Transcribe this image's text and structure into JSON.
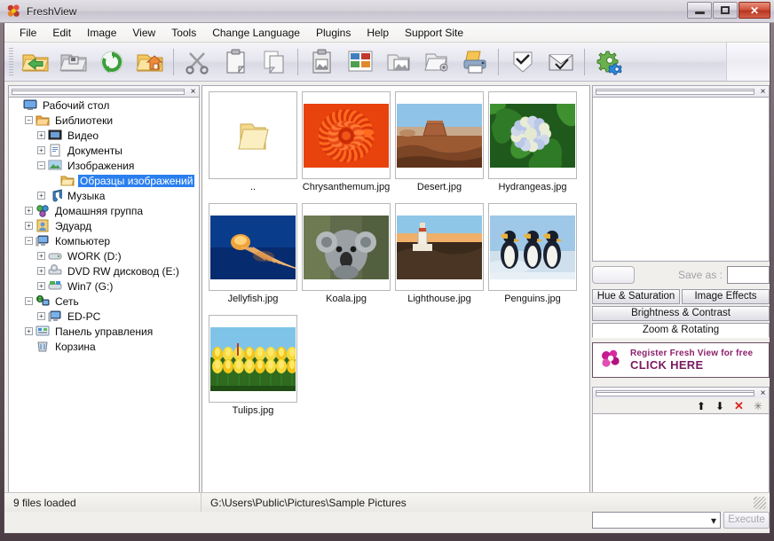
{
  "window": {
    "title": "FreshView",
    "icon": "app-flower-icon",
    "controls": {
      "minimize": "minimize",
      "maximize": "restore",
      "close": "close"
    }
  },
  "menu": [
    {
      "label": "File"
    },
    {
      "label": "Edit"
    },
    {
      "label": "Image"
    },
    {
      "label": "View"
    },
    {
      "label": "Tools"
    },
    {
      "label": "Change Language"
    },
    {
      "label": "Plugins"
    },
    {
      "label": "Help"
    },
    {
      "label": "Support Site"
    }
  ],
  "toolbar": {
    "groups": [
      {
        "buttons": [
          {
            "icon": "open-folder-icon"
          },
          {
            "icon": "save-folder-icon"
          },
          {
            "icon": "refresh-icon"
          },
          {
            "icon": "home-folder-icon"
          }
        ]
      },
      {
        "buttons": [
          {
            "icon": "cut-scissors-icon"
          },
          {
            "icon": "clipboard-copy-icon"
          },
          {
            "icon": "duplicate-pages-icon"
          }
        ]
      },
      {
        "buttons": [
          {
            "icon": "paste-image-icon"
          },
          {
            "icon": "thumbnails-grid-icon"
          },
          {
            "icon": "copy-to-folder-icon"
          },
          {
            "icon": "move-to-folder-icon"
          },
          {
            "icon": "print-icon"
          }
        ]
      },
      {
        "buttons": [
          {
            "icon": "select-check-icon"
          },
          {
            "icon": "send-mail-icon"
          }
        ]
      },
      {
        "buttons": [
          {
            "icon": "settings-gears-icon"
          }
        ]
      }
    ]
  },
  "tree": {
    "close_label": "×",
    "nodes": [
      {
        "label": "Рабочий стол",
        "indent": 0,
        "expander": "none",
        "icon": "desktop-icon",
        "selected": false
      },
      {
        "label": "Библиотеки",
        "indent": 1,
        "expander": "minus",
        "icon": "libraries-icon",
        "selected": false
      },
      {
        "label": "Видео",
        "indent": 2,
        "expander": "plus",
        "icon": "video-icon",
        "selected": false
      },
      {
        "label": "Документы",
        "indent": 2,
        "expander": "plus",
        "icon": "documents-icon",
        "selected": false
      },
      {
        "label": "Изображения",
        "indent": 2,
        "expander": "minus",
        "icon": "pictures-icon",
        "selected": false
      },
      {
        "label": "Образцы изображений",
        "indent": 3,
        "expander": "none",
        "icon": "folder-icon",
        "selected": true
      },
      {
        "label": "Музыка",
        "indent": 2,
        "expander": "plus",
        "icon": "music-icon",
        "selected": false
      },
      {
        "label": "Домашняя группа",
        "indent": 1,
        "expander": "plus",
        "icon": "homegroup-icon",
        "selected": false
      },
      {
        "label": "Эдуард",
        "indent": 1,
        "expander": "plus",
        "icon": "user-icon",
        "selected": false
      },
      {
        "label": "Компьютер",
        "indent": 1,
        "expander": "minus",
        "icon": "computer-icon",
        "selected": false
      },
      {
        "label": "WORK (D:)",
        "indent": 2,
        "expander": "plus",
        "icon": "harddrive-icon",
        "selected": false
      },
      {
        "label": "DVD RW дисковод (E:)",
        "indent": 2,
        "expander": "plus",
        "icon": "dvd-drive-icon",
        "selected": false
      },
      {
        "label": "Win7 (G:)",
        "indent": 2,
        "expander": "plus",
        "icon": "system-drive-icon",
        "selected": false
      },
      {
        "label": "Сеть",
        "indent": 1,
        "expander": "minus",
        "icon": "network-icon",
        "selected": false
      },
      {
        "label": "ED-PC",
        "indent": 2,
        "expander": "plus",
        "icon": "computer-icon",
        "selected": false
      },
      {
        "label": "Панель управления",
        "indent": 1,
        "expander": "plus",
        "icon": "control-panel-icon",
        "selected": false
      },
      {
        "label": "Корзина",
        "indent": 1,
        "expander": "none",
        "icon": "recycle-bin-icon",
        "selected": false
      }
    ]
  },
  "thumbnails": [
    {
      "name": "..",
      "kind": "parent-folder"
    },
    {
      "name": "Chrysanthemum.jpg",
      "kind": "image"
    },
    {
      "name": "Desert.jpg",
      "kind": "image"
    },
    {
      "name": "Hydrangeas.jpg",
      "kind": "image"
    },
    {
      "name": "Jellyfish.jpg",
      "kind": "image"
    },
    {
      "name": "Koala.jpg",
      "kind": "image"
    },
    {
      "name": "Lighthouse.jpg",
      "kind": "image"
    },
    {
      "name": "Penguins.jpg",
      "kind": "image"
    },
    {
      "name": "Tulips.jpg",
      "kind": "image"
    }
  ],
  "right_panel": {
    "close_label": "×",
    "save_button_label": "",
    "save_as_label": "Save as :",
    "save_as_value": "",
    "tabs": [
      {
        "label": "Hue & Saturation",
        "active": false
      },
      {
        "label": "Image Effects",
        "active": false
      },
      {
        "label": "Brightness & Contrast",
        "active": false
      },
      {
        "label": "Zoom & Rotating",
        "active": true
      }
    ],
    "banner": {
      "line1": "Register Fresh View for free",
      "line2": "CLICK HERE",
      "logo": "flower-logo-icon",
      "color": "#8c1f6b"
    },
    "list_tools": [
      {
        "icon": "move-up-icon",
        "glyph": "⬆"
      },
      {
        "icon": "move-down-icon",
        "glyph": "⬇"
      },
      {
        "icon": "delete-x-icon",
        "glyph": "✕"
      },
      {
        "icon": "sparkle-icon",
        "glyph": "✳"
      }
    ],
    "combo_value": "",
    "execute_label": "Execute"
  },
  "statusbar": {
    "files_loaded": "9 files loaded",
    "path": "G:\\Users\\Public\\Pictures\\Sample Pictures"
  },
  "colors": {
    "selection": "#2a7fef",
    "close_red": "#c0392b",
    "banner_magenta": "#c4198f"
  }
}
